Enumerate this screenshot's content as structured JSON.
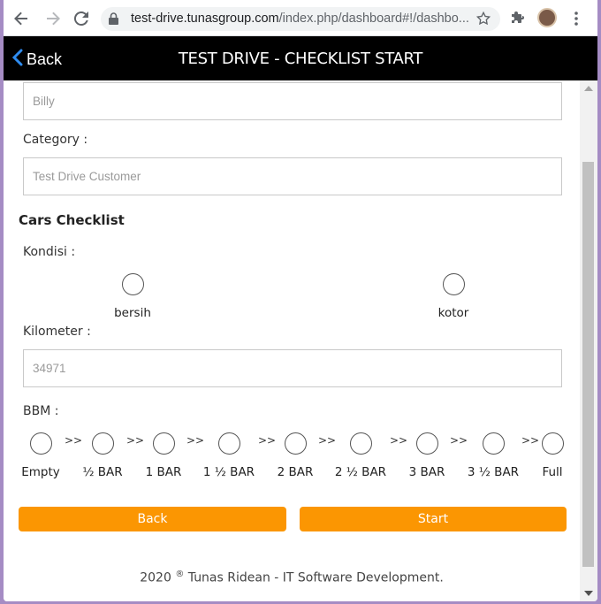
{
  "browser": {
    "url_host": "test-drive.tunasgroup.com",
    "url_path": "/index.php/dashboard#!/dashbo..."
  },
  "header": {
    "back_label": "Back",
    "title": "TEST DRIVE - CHECKLIST START"
  },
  "form": {
    "name_value": "Billy",
    "category_label": "Category :",
    "category_value": "Test Drive Customer",
    "section_title": "Cars Checklist",
    "kondisi_label": "Kondisi :",
    "kondisi_options": [
      "bersih",
      "kotor"
    ],
    "kilometer_label": "Kilometer :",
    "kilometer_value": "34971",
    "bbm_label": "BBM :",
    "bbm_separator": ">>",
    "bbm_options": [
      "Empty",
      "½ BAR",
      "1 BAR",
      "1 ½ BAR",
      "2 BAR",
      "2 ½ BAR",
      "3 BAR",
      "3 ½ BAR",
      "Full"
    ]
  },
  "buttons": {
    "back_label": "Back",
    "start_label": "Start"
  },
  "footer": {
    "year": "2020",
    "mark": "®",
    "text": " Tunas Ridean - IT Software Development."
  },
  "colors": {
    "accent": "#fb9602",
    "header_bg": "#000000"
  }
}
